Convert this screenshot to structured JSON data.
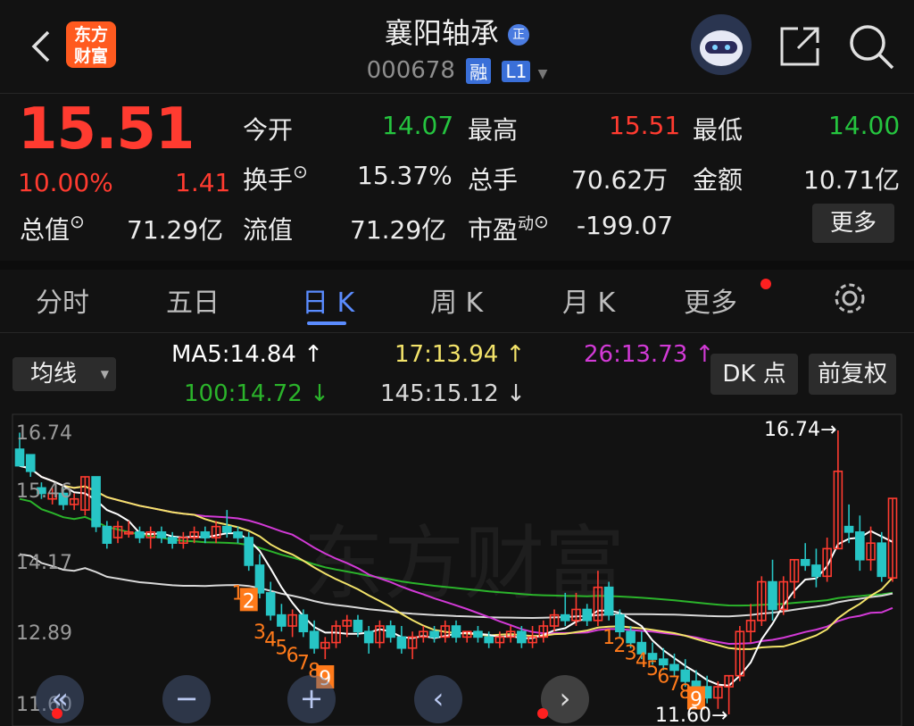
{
  "header": {
    "logo": [
      "东方",
      "财富"
    ],
    "title": "襄阳轴承",
    "title_badge": "正",
    "code": "000678",
    "badge_margin": "融",
    "badge_level": "L1"
  },
  "quote": {
    "price": "15.51",
    "change_pct": "10.00%",
    "change": "1.41",
    "open_label": "今开",
    "open": "14.07",
    "high_label": "最高",
    "high": "15.51",
    "low_label": "最低",
    "low": "14.00",
    "turnover_label": "换手",
    "turnover": "15.37%",
    "volume_label": "总手",
    "volume": "70.62万",
    "amount_label": "金额",
    "amount": "10.71亿",
    "mktcap_label": "总值",
    "mktcap": "71.29亿",
    "float_label": "流值",
    "float": "71.29亿",
    "pe_label": "市盈",
    "pe_sup": "动",
    "pe": "-199.07",
    "more": "更多"
  },
  "tabs": [
    "分时",
    "五日",
    "日 K",
    "周 K",
    "月 K",
    "更多"
  ],
  "active_tab": "日 K",
  "toolbar": {
    "ma_select": "均线",
    "ma5": "MA5:14.84 ↑",
    "ma17": "17:13.94 ↑",
    "ma26": "26:13.73 ↑",
    "ma100": "100:14.72 ↓",
    "ma145": "145:15.12 ↓",
    "dk_button": "DK 点",
    "fq_button": "前复权"
  },
  "colors": {
    "up": "#ff3b30",
    "down": "#25c43f",
    "accent": "#5a8cff",
    "ma5": "#ffffff",
    "ma17": "#f3e36a",
    "ma26": "#d23ad6",
    "ma100": "#2bb42b",
    "ma145": "#d8d8d8",
    "candle_down": "#27c5c5",
    "seq": "#ff7a1a"
  },
  "chart_data": {
    "type": "candlestick",
    "y_axis_labels": [
      "16.74",
      "15.46",
      "14.17",
      "12.89",
      "11.60"
    ],
    "ylim": [
      11.6,
      16.74
    ],
    "max_label": "16.74→",
    "min_label": "11.60→",
    "watermark": "东方财富",
    "candles": [
      [
        16.4,
        16.7,
        16.2,
        16.1
      ],
      [
        16.3,
        16.3,
        15.9,
        16.0
      ],
      [
        15.7,
        15.8,
        15.5,
        15.6
      ],
      [
        15.5,
        15.7,
        15.4,
        15.6
      ],
      [
        15.6,
        15.7,
        15.3,
        15.4
      ],
      [
        15.4,
        15.6,
        15.3,
        15.5
      ],
      [
        15.3,
        15.9,
        15.2,
        15.9
      ],
      [
        15.9,
        15.9,
        14.9,
        15.0
      ],
      [
        15.0,
        15.1,
        14.6,
        14.7
      ],
      [
        14.8,
        15.1,
        14.7,
        15.0
      ],
      [
        14.9,
        15.1,
        14.8,
        14.9
      ],
      [
        14.9,
        15.0,
        14.7,
        14.8
      ],
      [
        14.8,
        15.0,
        14.6,
        14.9
      ],
      [
        14.9,
        15.0,
        14.7,
        14.8
      ],
      [
        14.8,
        14.9,
        14.6,
        14.7
      ],
      [
        14.7,
        14.9,
        14.6,
        14.8
      ],
      [
        14.8,
        15.0,
        14.7,
        14.9
      ],
      [
        14.9,
        15.0,
        14.7,
        14.8
      ],
      [
        14.8,
        15.1,
        14.7,
        15.0
      ],
      [
        15.0,
        15.3,
        14.8,
        14.9
      ],
      [
        14.9,
        15.0,
        14.7,
        14.8
      ],
      [
        14.8,
        14.9,
        14.2,
        14.3
      ],
      [
        14.3,
        14.5,
        13.7,
        13.8
      ],
      [
        13.8,
        14.0,
        13.3,
        13.4
      ],
      [
        13.4,
        13.6,
        13.1,
        13.2
      ],
      [
        13.2,
        13.5,
        13.0,
        13.4
      ],
      [
        13.4,
        13.5,
        13.0,
        13.1
      ],
      [
        13.1,
        13.3,
        12.7,
        12.8
      ],
      [
        12.8,
        13.0,
        12.6,
        12.9
      ],
      [
        12.9,
        13.3,
        12.8,
        13.2
      ],
      [
        13.2,
        13.4,
        13.0,
        13.3
      ],
      [
        13.3,
        13.4,
        13.0,
        13.1
      ],
      [
        13.1,
        13.2,
        12.7,
        12.9
      ],
      [
        12.9,
        13.3,
        12.8,
        13.2
      ],
      [
        13.2,
        13.3,
        12.9,
        13.0
      ],
      [
        13.0,
        13.2,
        12.7,
        12.8
      ],
      [
        12.8,
        13.1,
        12.6,
        13.0
      ],
      [
        13.0,
        13.2,
        12.9,
        13.1
      ],
      [
        13.1,
        13.2,
        12.9,
        13.0
      ],
      [
        13.0,
        13.3,
        12.9,
        13.2
      ],
      [
        13.2,
        13.3,
        12.9,
        13.0
      ],
      [
        13.0,
        13.1,
        12.9,
        13.1
      ],
      [
        13.1,
        13.2,
        12.9,
        13.0
      ],
      [
        13.0,
        13.1,
        12.8,
        12.9
      ],
      [
        12.9,
        13.1,
        12.8,
        13.0
      ],
      [
        13.0,
        13.2,
        12.9,
        13.1
      ],
      [
        13.1,
        13.2,
        12.8,
        12.9
      ],
      [
        12.9,
        13.2,
        12.8,
        13.0
      ],
      [
        13.0,
        13.3,
        12.9,
        13.2
      ],
      [
        13.2,
        13.5,
        13.1,
        13.4
      ],
      [
        13.4,
        13.8,
        13.2,
        13.3
      ],
      [
        13.3,
        13.8,
        13.2,
        13.5
      ],
      [
        13.5,
        13.6,
        13.2,
        13.3
      ],
      [
        13.3,
        14.2,
        13.2,
        13.9
      ],
      [
        13.9,
        14.0,
        13.3,
        13.4
      ],
      [
        13.4,
        13.5,
        13.0,
        13.1
      ],
      [
        13.1,
        13.2,
        12.8,
        12.9
      ],
      [
        12.9,
        13.1,
        12.6,
        12.7
      ],
      [
        12.7,
        12.9,
        12.5,
        12.6
      ],
      [
        12.6,
        12.8,
        12.4,
        12.5
      ],
      [
        12.5,
        12.7,
        12.3,
        12.4
      ],
      [
        12.4,
        12.6,
        12.1,
        12.2
      ],
      [
        12.2,
        12.4,
        12.0,
        12.1
      ],
      [
        12.1,
        12.3,
        11.8,
        11.9
      ],
      [
        11.9,
        12.2,
        11.7,
        12.1
      ],
      [
        12.1,
        12.3,
        11.6,
        12.3
      ],
      [
        12.3,
        13.2,
        12.2,
        13.1
      ],
      [
        13.1,
        13.6,
        12.9,
        13.3
      ],
      [
        13.3,
        14.1,
        13.2,
        14.0
      ],
      [
        14.0,
        14.4,
        13.3,
        13.5
      ],
      [
        13.5,
        14.1,
        13.4,
        14.0
      ],
      [
        14.0,
        14.4,
        13.7,
        14.4
      ],
      [
        14.4,
        14.7,
        14.2,
        14.3
      ],
      [
        14.3,
        14.6,
        13.9,
        14.1
      ],
      [
        14.1,
        14.8,
        14.0,
        14.6
      ],
      [
        14.6,
        16.74,
        14.6,
        16.0
      ],
      [
        15.0,
        15.4,
        14.7,
        14.9
      ],
      [
        14.9,
        15.2,
        14.2,
        14.4
      ],
      [
        14.4,
        15.0,
        14.2,
        14.7
      ],
      [
        14.7,
        14.9,
        14.0,
        14.1
      ],
      [
        14.07,
        15.51,
        14.0,
        15.51
      ]
    ]
  },
  "sequence_labels": {
    "a": [
      "1",
      "2",
      "3",
      "4",
      "5",
      "6",
      "7",
      "8",
      "9"
    ],
    "b": [
      "1",
      "2",
      "3",
      "4",
      "5",
      "6",
      "7",
      "8",
      "9"
    ]
  },
  "controls": [
    "«",
    "−",
    "+",
    "‹",
    "›"
  ]
}
